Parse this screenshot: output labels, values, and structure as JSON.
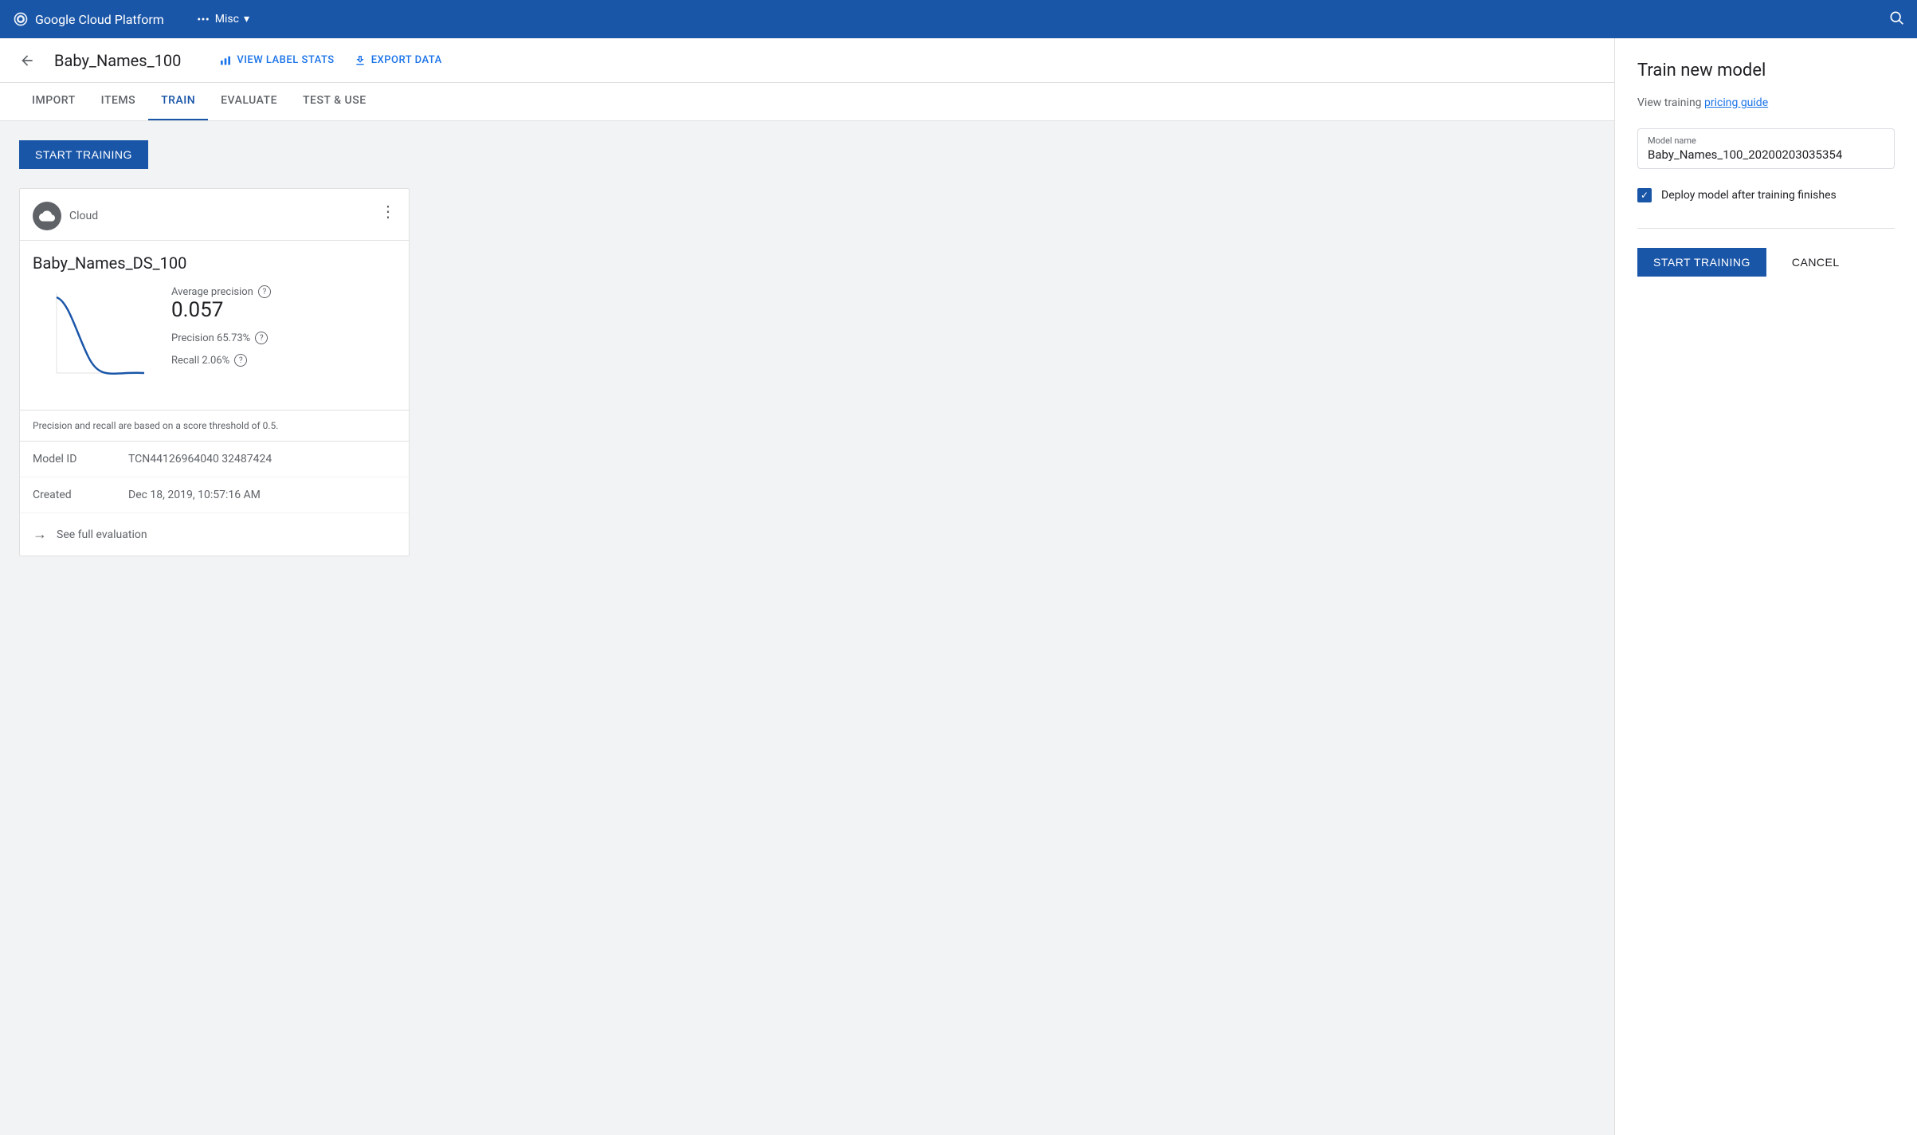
{
  "topbar": {
    "logo_text": "Google Cloud Platform",
    "project_name": "Misc",
    "dropdown_icon": "▾"
  },
  "subheader": {
    "title": "Baby_Names_100",
    "view_label_stats": "VIEW LABEL STATS",
    "export_data": "EXPORT DATA"
  },
  "tabs": [
    {
      "id": "import",
      "label": "IMPORT",
      "active": false
    },
    {
      "id": "items",
      "label": "ITEMS",
      "active": false
    },
    {
      "id": "train",
      "label": "TRAIN",
      "active": true
    },
    {
      "id": "evaluate",
      "label": "EVALUATE",
      "active": false
    },
    {
      "id": "test-use",
      "label": "TEST & USE",
      "active": false
    }
  ],
  "content": {
    "start_training_btn": "START TRAINING",
    "model_card": {
      "cloud_label": "Cloud",
      "model_name": "Baby_Names_DS_100",
      "avg_precision_label": "Average precision",
      "avg_precision_help": "?",
      "avg_precision_value": "0.057",
      "precision_label": "Precision 65.73%",
      "precision_help": "?",
      "recall_label": "Recall 2.06%",
      "recall_help": "?",
      "score_note": "Precision and recall are based on a score threshold of 0.5.",
      "model_id_label": "Model ID",
      "model_id_value": "TCN44126964040 32487424",
      "created_label": "Created",
      "created_value": "Dec 18, 2019, 10:57:16 AM",
      "see_full_evaluation": "See full evaluation"
    }
  },
  "right_panel": {
    "title": "Train new model",
    "pricing_text": "View training ",
    "pricing_link": "pricing guide",
    "model_name_label": "Model name",
    "model_name_value": "Baby_Names_100_20200203035354",
    "deploy_label": "Deploy model after training finishes",
    "start_btn": "START TRAINING",
    "cancel_btn": "CANCEL"
  },
  "chart": {
    "accent_color": "#1a56a8"
  }
}
